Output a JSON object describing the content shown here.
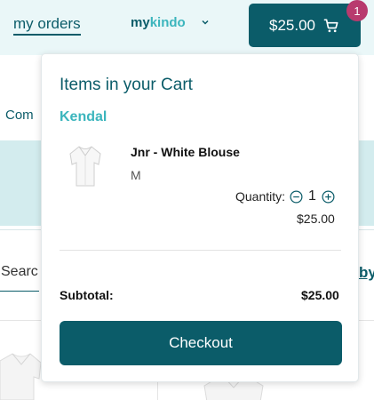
{
  "header": {
    "my_orders_label": "my orders",
    "brand_part1": "my",
    "brand_part2": "kindo",
    "cart_total": "$25.00",
    "cart_count": "1"
  },
  "background": {
    "partial_nav_text": "Com",
    "search_partial": "Searc",
    "sort_partial": "by"
  },
  "cart": {
    "title": "Items in your Cart",
    "student_name": "Kendal",
    "items": [
      {
        "name": "Jnr - White Blouse",
        "size": "M",
        "quantity_label": "Quantity:",
        "quantity": "1",
        "price": "$25.00"
      }
    ],
    "subtotal_label": "Subtotal:",
    "subtotal_value": "$25.00",
    "checkout_label": "Checkout"
  },
  "colors": {
    "primary": "#0b5c69",
    "accent": "#3bb5bd",
    "badge": "#b83a6e",
    "header_bg": "#eaf7f8",
    "band_bg": "#d3ecee"
  },
  "icons": {
    "cart": "cart-icon",
    "brand_dropdown": "chevron-down-icon",
    "qty_decrease": "minus-circle-icon",
    "qty_increase": "plus-circle-icon"
  }
}
